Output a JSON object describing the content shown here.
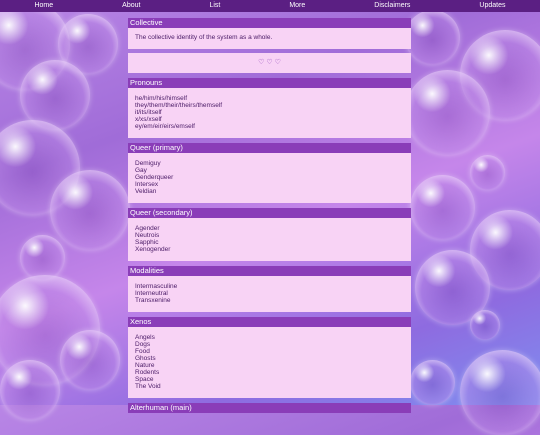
{
  "nav": [
    "Home",
    "About",
    "List",
    "More",
    "Disclaimers",
    "Updates"
  ],
  "sections": [
    {
      "title": "Collective",
      "items": [
        "The collective identity of the system as a whole."
      ],
      "footer": "♡ ♡ ♡"
    },
    {
      "title": "Pronouns",
      "items": [
        "he/him/his/himself",
        "they/them/their/theirs/themself",
        "it/its/itself",
        "x/xs/xself",
        "ey/em/eir/eirs/emself"
      ]
    },
    {
      "title": "Queer (primary)",
      "items": [
        "Demiguy",
        "Gay",
        "Genderqueer",
        "Intersex",
        "Veldian"
      ]
    },
    {
      "title": "Queer (secondary)",
      "items": [
        "Agender",
        "Neutrois",
        "Sapphic",
        "Xenogender"
      ]
    },
    {
      "title": "Modalities",
      "items": [
        "Intermasculine",
        "Interneutral",
        "Transxenine"
      ]
    },
    {
      "title": "Xenos",
      "items": [
        "Angels",
        "Dogs",
        "Food",
        "Ghosts",
        "Nature",
        "Rodents",
        "Space",
        "The Void"
      ]
    },
    {
      "title": "Alterhuman (main)",
      "items": []
    }
  ]
}
